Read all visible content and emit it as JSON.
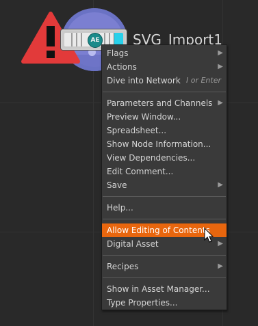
{
  "node": {
    "label": "SVG_Import1",
    "badge": "AE",
    "icon": "asset-node-icon",
    "warning_icon": "warning-icon"
  },
  "colors": {
    "background": "#292929",
    "menu_bg": "#3a3a3a",
    "highlight": "#e8660e",
    "warning": "#e23a3a",
    "node_disc": "#7b7fd1"
  },
  "menu": {
    "flags": "Flags",
    "actions": "Actions",
    "dive": "Dive into Network",
    "dive_shortcut": "I or Enter",
    "parameters": "Parameters and Channels",
    "preview": "Preview Window...",
    "spreadsheet": "Spreadsheet...",
    "node_info": "Show Node Information...",
    "dependencies": "View Dependencies...",
    "edit_comment": "Edit Comment...",
    "save": "Save",
    "help": "Help...",
    "allow_editing": "Allow Editing of Contents",
    "digital_asset": "Digital Asset",
    "recipes": "Recipes",
    "asset_manager": "Show in Asset Manager...",
    "type_properties": "Type Properties..."
  }
}
